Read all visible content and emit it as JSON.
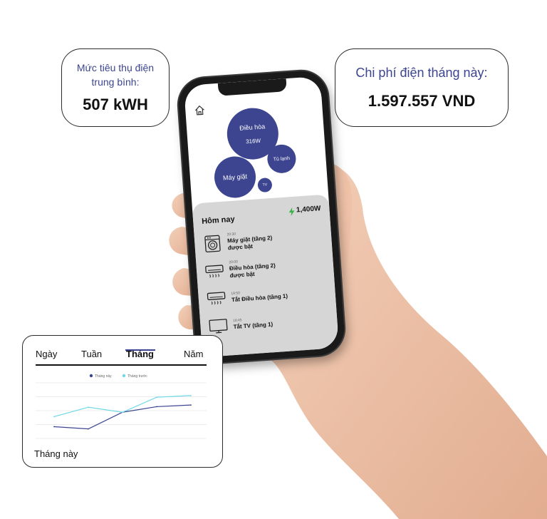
{
  "card_consumption": {
    "label": "Mức tiêu thụ điện trung bình:",
    "value": "507 kWH"
  },
  "card_cost": {
    "label": "Chi phí điện tháng này:",
    "value": "1.597.557 VND"
  },
  "phone": {
    "home_icon": "home-icon",
    "bubbles": {
      "dieu_hoa_label": "Điều hòa",
      "dieu_hoa_value": "316W",
      "may_giat": "Máy giặt",
      "tu_lanh": "Tủ lạnh",
      "tv": "TV"
    },
    "today": {
      "title": "Hôm nay",
      "power_value": "1,400",
      "power_unit": "W",
      "power_icon": "lightning-icon",
      "events": [
        {
          "time": "20:30",
          "line1": "Máy giặt (tầng 2)",
          "line2": "được bật",
          "icon": "washing-machine-icon"
        },
        {
          "time": "20:00",
          "line1": "Điều hòa (tầng 2)",
          "line2": "được bật",
          "icon": "air-conditioner-icon"
        },
        {
          "time": "19:50",
          "line1": "Tắt Điều hòa (tầng 1)",
          "line2": "",
          "icon": "air-conditioner-icon"
        },
        {
          "time": "18:45",
          "line1": "Tắt TV (tầng 1)",
          "line2": "",
          "icon": "tv-icon"
        }
      ]
    }
  },
  "chart_card": {
    "tabs": [
      "Ngày",
      "Tuần",
      "Tháng",
      "Năm"
    ],
    "active_tab": "Tháng",
    "caption": "Tháng này",
    "colors": {
      "this_month": "#3d4590",
      "last_month": "#6fd9e6",
      "accent": "#3d4590"
    }
  },
  "chart_data": {
    "type": "line",
    "title": "",
    "xlabel": "",
    "ylabel": "",
    "x": [
      1,
      2,
      3,
      4,
      5
    ],
    "ylim": [
      0,
      100
    ],
    "grid": true,
    "legend": "top-center",
    "series": [
      {
        "name": "Tháng này",
        "values": [
          16,
          12,
          42,
          52,
          55
        ]
      },
      {
        "name": "Tháng trước",
        "values": [
          34,
          51,
          42,
          69,
          72
        ]
      }
    ]
  }
}
